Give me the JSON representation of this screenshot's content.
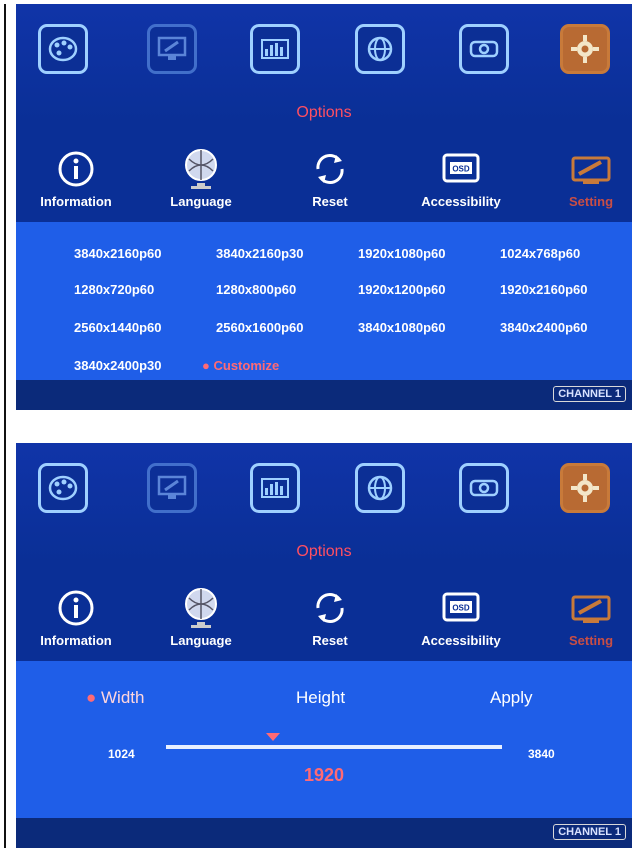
{
  "colors": {
    "panel_bg": "#0a2f96",
    "content_bg": "#1f5ee8",
    "accent_red": "#ff4f62",
    "setting_orange": "#b86a33"
  },
  "top_icons": [
    {
      "name": "palette-icon"
    },
    {
      "name": "monitor-tools-icon"
    },
    {
      "name": "bars-icon"
    },
    {
      "name": "globe-icon"
    },
    {
      "name": "projector-icon"
    },
    {
      "name": "gear-icon"
    }
  ],
  "menu": {
    "title": "Options",
    "items": [
      {
        "label": "Information",
        "icon": "info-icon"
      },
      {
        "label": "Language",
        "icon": "globe-icon"
      },
      {
        "label": "Reset",
        "icon": "reset-icon"
      },
      {
        "label": "Accessibility",
        "icon": "osd-icon",
        "icon_text": "OSD"
      },
      {
        "label": "Setting",
        "icon": "tools-icon"
      }
    ]
  },
  "panel1": {
    "resolutions": [
      "3840x2160p60",
      "3840x2160p30",
      "1920x1080p60",
      "1024x768p60",
      "1280x720p60",
      "1280x800p60",
      "1920x1200p60",
      "1920x2160p60",
      "2560x1440p60",
      "2560x1600p60",
      "3840x1080p60",
      "3840x2400p60",
      "3840x2400p30",
      "Customize"
    ],
    "selected": "Customize",
    "channel": "CHANNEL 1"
  },
  "panel2": {
    "tabs": [
      "Width",
      "Height",
      "Apply"
    ],
    "selected_tab": "Width",
    "slider": {
      "min": "1024",
      "max": "3840",
      "value": "1920",
      "fraction": 0.318
    },
    "channel": "CHANNEL 1"
  }
}
